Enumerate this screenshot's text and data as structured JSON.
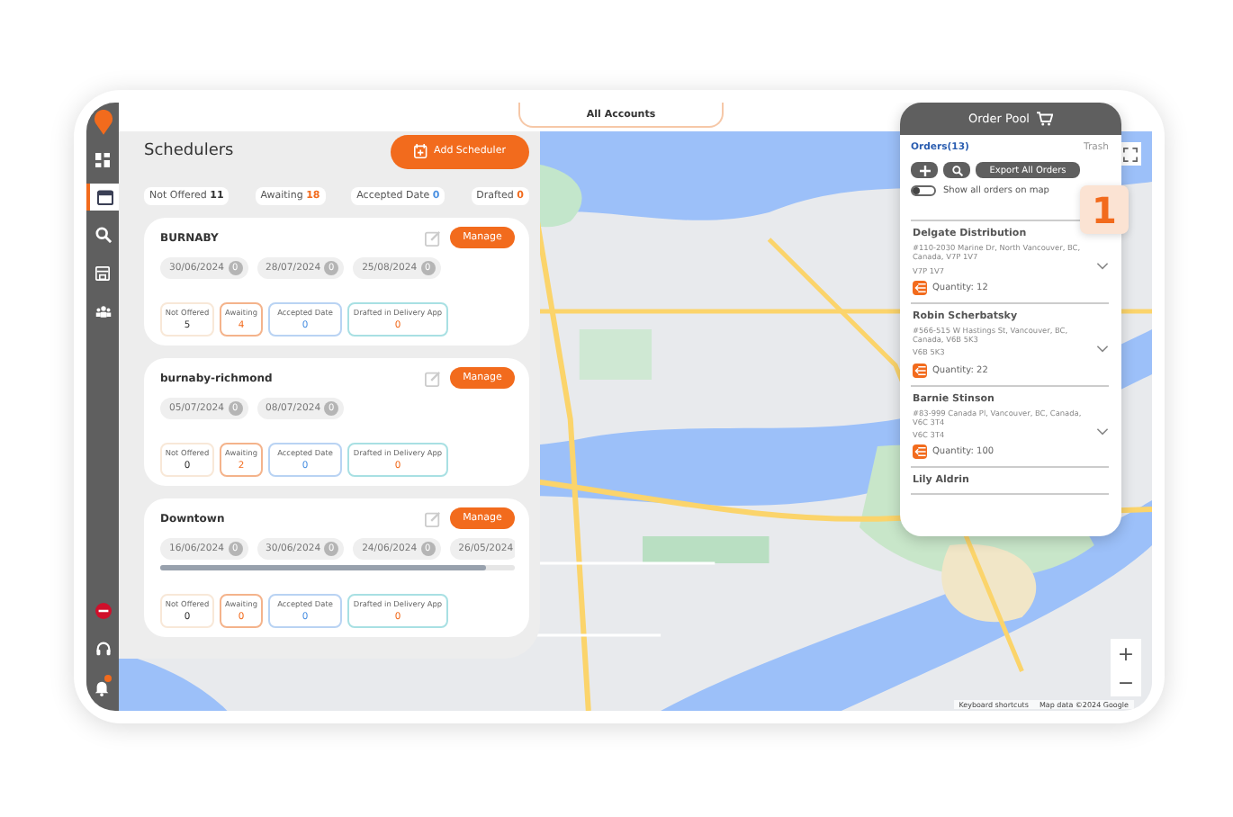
{
  "sidebar": {
    "items": [
      {
        "kind": "logo",
        "selected": false
      },
      {
        "kind": "dashboard",
        "selected": false
      },
      {
        "kind": "calendar",
        "selected": true
      },
      {
        "kind": "search",
        "selected": false
      },
      {
        "kind": "store",
        "selected": false
      },
      {
        "kind": "team",
        "selected": false
      }
    ],
    "bottom_items": [
      {
        "kind": "stop"
      },
      {
        "kind": "headset"
      },
      {
        "kind": "bell",
        "badge": true
      }
    ]
  },
  "top_tab": {
    "label": "All Accounts"
  },
  "schedulers": {
    "title": "Schedulers",
    "add_button": "Add Scheduler",
    "summary": [
      {
        "label": "Not Offered",
        "count": "11",
        "color": "#333333"
      },
      {
        "label": "Awaiting",
        "count": "18",
        "color": "#f26b1d"
      },
      {
        "label": "Accepted Date",
        "count": "0",
        "color": "#4a90e2"
      },
      {
        "label": "Drafted",
        "count": "0",
        "color": "#f26b1d"
      }
    ],
    "cards": [
      {
        "name": "BURNABY",
        "manage": "Manage",
        "scrollbar": false,
        "dates": [
          {
            "date": "30/06/2024",
            "count": "0"
          },
          {
            "date": "28/07/2024",
            "count": "0"
          },
          {
            "date": "25/08/2024",
            "count": "0"
          }
        ],
        "stats": [
          {
            "label": "Not Offered",
            "value": "5"
          },
          {
            "label": "Awaiting",
            "value": "4"
          },
          {
            "label": "Accepted Date",
            "value": "0"
          },
          {
            "label": "Drafted in Delivery App",
            "value": "0"
          }
        ]
      },
      {
        "name": "burnaby-richmond",
        "manage": "Manage",
        "scrollbar": false,
        "dates": [
          {
            "date": "05/07/2024",
            "count": "0"
          },
          {
            "date": "08/07/2024",
            "count": "0"
          }
        ],
        "stats": [
          {
            "label": "Not Offered",
            "value": "0"
          },
          {
            "label": "Awaiting",
            "value": "2"
          },
          {
            "label": "Accepted Date",
            "value": "0"
          },
          {
            "label": "Drafted in Delivery App",
            "value": "0"
          }
        ]
      },
      {
        "name": "Downtown",
        "manage": "Manage",
        "scrollbar": true,
        "dates": [
          {
            "date": "16/06/2024",
            "count": "0"
          },
          {
            "date": "30/06/2024",
            "count": "0"
          },
          {
            "date": "24/06/2024",
            "count": "0"
          },
          {
            "date": "26/05/2024"
          }
        ],
        "stats": [
          {
            "label": "Not Offered",
            "value": "0"
          },
          {
            "label": "Awaiting",
            "value": "0"
          },
          {
            "label": "Accepted Date",
            "value": "0"
          },
          {
            "label": "Drafted in Delivery App",
            "value": "0"
          }
        ]
      }
    ]
  },
  "order_pool": {
    "title": "Order Pool",
    "tabs": [
      {
        "label": "Orders(13)",
        "selected": true
      },
      {
        "label": "Trash",
        "selected": false
      }
    ],
    "export_button": "Export All Orders",
    "toggle": {
      "label": "Show all orders on map",
      "on": false
    },
    "orders": [
      {
        "name": "Delgate Distribution",
        "address": "#110-2030 Marine Dr, North Vancouver, BC, Canada, V7P 1V7",
        "postal": "V7P 1V7",
        "quantity": "Quantity: 12"
      },
      {
        "name": "Robin Scherbatsky",
        "address": "#566-515 W Hastings St, Vancouver, BC, Canada, V6B 5K3",
        "postal": "V6B 5K3",
        "quantity": "Quantity: 22"
      },
      {
        "name": "Barnie Stinson",
        "address": "#83-999 Canada Pl, Vancouver, BC, Canada, V6C 3T4",
        "postal": "V6C 3T4",
        "quantity": "Quantity: 100"
      },
      {
        "name": "Lily Aldrin"
      }
    ]
  },
  "step_badge": "1",
  "map": {
    "zoom_in": "+",
    "zoom_out": "−",
    "footer": [
      "Keyboard shortcuts",
      "Map data ©2024 Google"
    ]
  }
}
